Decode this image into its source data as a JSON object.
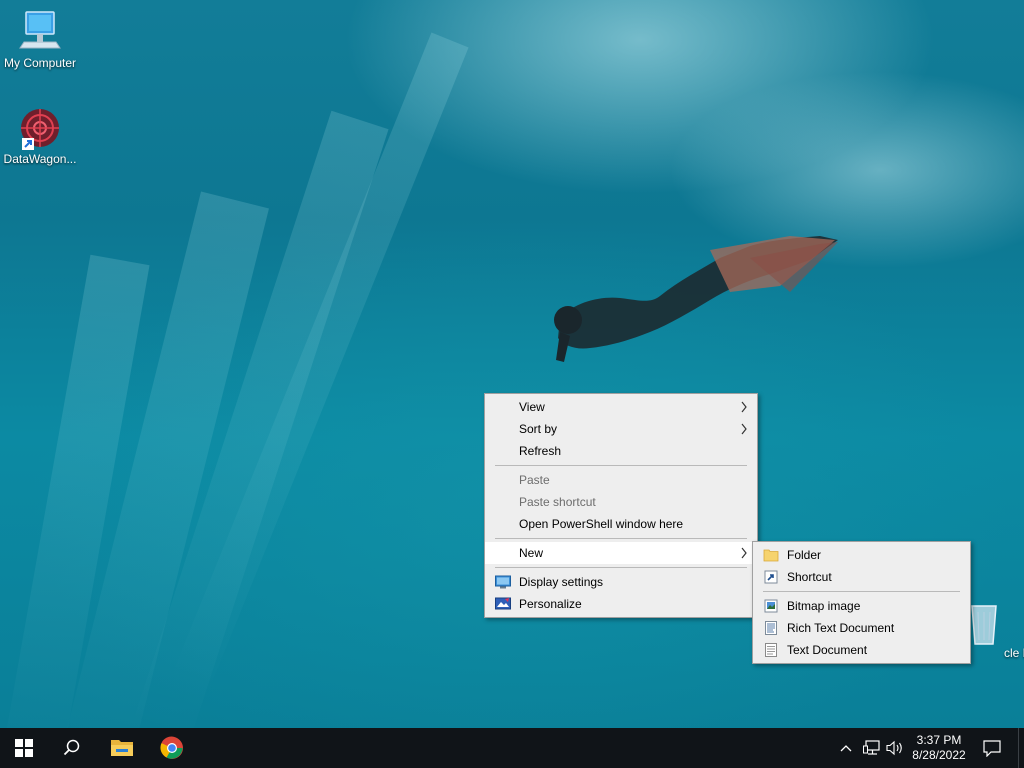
{
  "desktop": {
    "icons": [
      {
        "label": "My Computer",
        "icon": "computer-icon"
      },
      {
        "label": "DataWagon...",
        "icon": "datawagon-shortcut-icon"
      },
      {
        "label": "cle Bin",
        "icon": "recycle-bin-icon"
      }
    ]
  },
  "context_menu": {
    "items": {
      "view": "View",
      "sort_by": "Sort by",
      "refresh": "Refresh",
      "paste": "Paste",
      "paste_shortcut": "Paste shortcut",
      "open_powershell": "Open PowerShell window here",
      "new": "New",
      "display_settings": "Display settings",
      "personalize": "Personalize"
    }
  },
  "new_submenu": {
    "items": {
      "folder": "Folder",
      "shortcut": "Shortcut",
      "bitmap": "Bitmap image",
      "rich_text": "Rich Text Document",
      "text_document": "Text Document"
    }
  },
  "taskbar": {
    "apps": [
      "start-icon",
      "search-icon",
      "file-explorer-icon",
      "chrome-icon"
    ],
    "tray": {
      "time": "3:37 PM",
      "date": "8/28/2022"
    }
  },
  "colors": {
    "menu_bg": "#eeeeee",
    "menu_highlight": "#ffffff",
    "taskbar_bg": "#101418",
    "disabled_text": "#6d6d6d"
  }
}
